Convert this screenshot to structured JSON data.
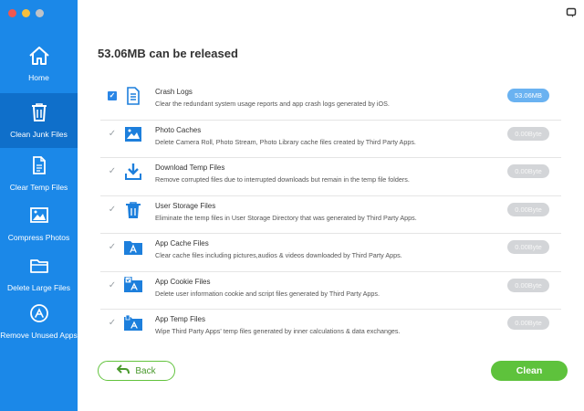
{
  "sidebar": {
    "items": [
      {
        "label": "Home",
        "icon": "home-icon"
      },
      {
        "label": "Clean Junk Files",
        "icon": "trash-icon",
        "active": true
      },
      {
        "label": "Clear Temp Files",
        "icon": "temp-files-icon"
      },
      {
        "label": "Compress Photos",
        "icon": "photo-icon"
      },
      {
        "label": "Delete Large Files",
        "icon": "folder-icon"
      },
      {
        "label": "Remove Unused Apps",
        "icon": "app-store-icon"
      }
    ]
  },
  "main": {
    "heading": "53.06MB can be released",
    "rows": [
      {
        "title": "Crash Logs",
        "desc": "Clear the redundant system usage reports and app crash logs generated by iOS.",
        "size": "53.06MB",
        "checked": true,
        "icon": "document-icon"
      },
      {
        "title": "Photo Caches",
        "desc": "Delete Camera Roll, Photo Stream, Photo Library cache files created by Third Party Apps.",
        "size": "0.00Byte",
        "checked": true,
        "icon": "photo-icon"
      },
      {
        "title": "Download Temp Files",
        "desc": "Remove corrupted files due to interrupted downloads but remain in the temp file folders.",
        "size": "0.00Byte",
        "checked": true,
        "icon": "download-icon"
      },
      {
        "title": "User Storage Files",
        "desc": "Eliminate the temp files in User Storage Directory that was generated by Third Party Apps.",
        "size": "0.00Byte",
        "checked": true,
        "icon": "trash-icon"
      },
      {
        "title": "App Cache Files",
        "desc": "Clear cache files including pictures,audios & videos downloaded by Third Party Apps.",
        "size": "0.00Byte",
        "checked": true,
        "icon": "app-folder-icon"
      },
      {
        "title": "App Cookie Files",
        "desc": "Delete user information cookie and script files generated by Third Party Apps.",
        "size": "0.00Byte",
        "checked": true,
        "icon": "cookie-folder-icon"
      },
      {
        "title": "App Temp Files",
        "desc": "Wipe Third Party Apps' temp files generated by inner calculations & data exchanges.",
        "size": "0.00Byte",
        "checked": true,
        "icon": "temp-folder-icon"
      }
    ]
  },
  "buttons": {
    "back_label": "Back",
    "clean_label": "Clean"
  },
  "colors": {
    "sidebar": "#1b88e8",
    "sidebar_active": "#0f6fca",
    "accent_green": "#5ec23c",
    "size_highlight": "#6ab2f1",
    "icon_blue": "#1d7fdc"
  }
}
